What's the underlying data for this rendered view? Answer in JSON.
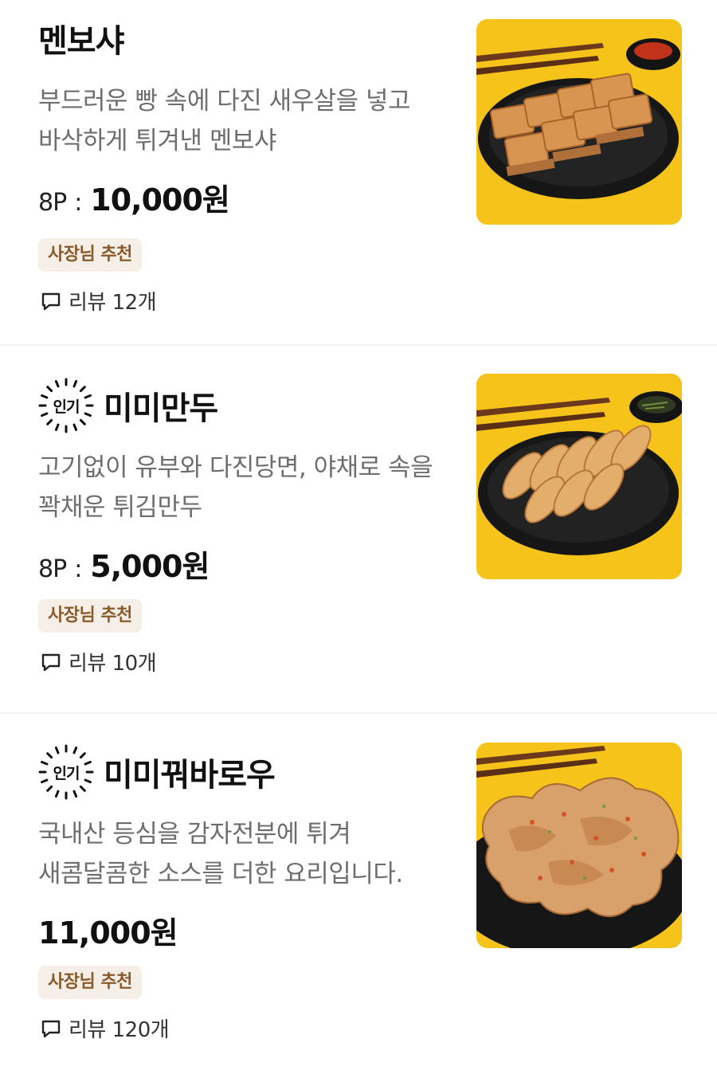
{
  "menu_items": [
    {
      "name": "멘보샤",
      "popular": false,
      "description": "부드러운 빵 속에 다진 새우살을 넣고\n바삭하게 튀겨낸 멘보샤",
      "price_label": "8P",
      "price": "10,000원",
      "badge": "사장님 추천",
      "review_text": "리뷰 12개"
    },
    {
      "name": "미미만두",
      "popular": true,
      "popular_label": "인기",
      "description": "고기없이 유부와 다진당면, 야채로 속을\n꽉채운  튀김만두",
      "price_label": "8P",
      "price": "5,000원",
      "badge": "사장님 추천",
      "review_text": "리뷰 10개"
    },
    {
      "name": "미미꿔바로우",
      "popular": true,
      "popular_label": "인기",
      "description": "국내산 등심을 감자전분에 튀겨\n새콤달콤한 소스를 더한 요리입니다.",
      "price": "11,000원",
      "badge": "사장님 추천",
      "review_text": "리뷰 120개"
    }
  ],
  "colors": {
    "photo_background": "#f6c31b",
    "badge_background": "#f6efe7",
    "badge_text": "#8a5a2a",
    "description_text": "#6e6e6e"
  },
  "icons": {
    "popular": "sunburst-popular-icon",
    "review": "speech-bubble-icon"
  }
}
